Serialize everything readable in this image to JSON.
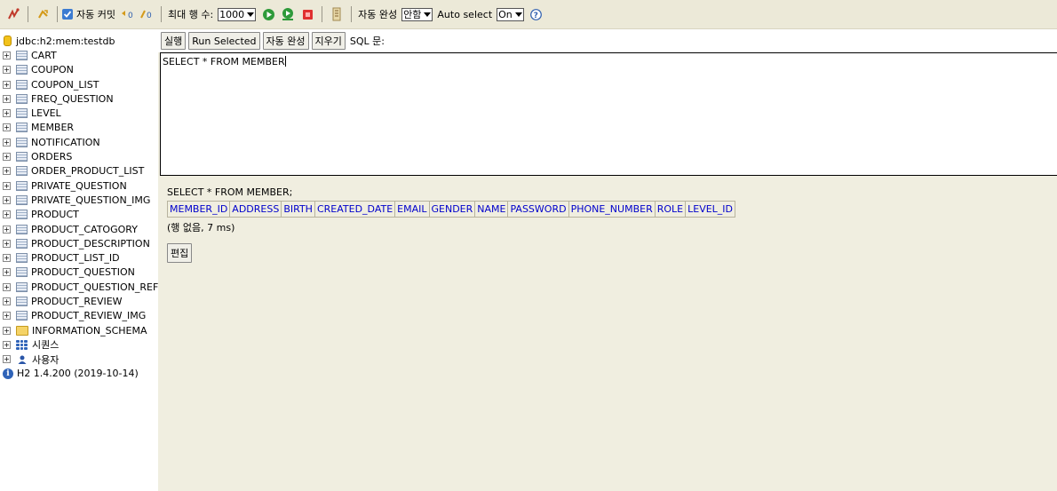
{
  "toolbar": {
    "autocommit_label": "자동 커밋",
    "max_rows_label": "최대 행 수:",
    "max_rows_value": "1000",
    "autocomplete_label": "자동 완성",
    "autocomplete_value": "안함",
    "auto_select_label": "Auto select",
    "auto_select_value": "On",
    "help_icon": "?"
  },
  "sidebar": {
    "connection": "jdbc:h2:mem:testdb",
    "tables": [
      "CART",
      "COUPON",
      "COUPON_LIST",
      "FREQ_QUESTION",
      "LEVEL",
      "MEMBER",
      "NOTIFICATION",
      "ORDERS",
      "ORDER_PRODUCT_LIST",
      "PRIVATE_QUESTION",
      "PRIVATE_QUESTION_IMG",
      "PRODUCT",
      "PRODUCT_CATOGORY",
      "PRODUCT_DESCRIPTION",
      "PRODUCT_LIST_ID",
      "PRODUCT_QUESTION",
      "PRODUCT_QUESTION_REF",
      "PRODUCT_REVIEW",
      "PRODUCT_REVIEW_IMG"
    ],
    "schema": "INFORMATION_SCHEMA",
    "sequences": "시퀀스",
    "users": "사용자",
    "version": "H2 1.4.200 (2019-10-14)"
  },
  "sql_bar": {
    "run_label": "실행",
    "run_selected_label": "Run Selected",
    "autocomplete_label": "자동 완성",
    "clear_label": "지우기",
    "sql_label": "SQL 문:"
  },
  "editor": {
    "text": "SELECT * FROM MEMBER"
  },
  "results": {
    "statement": "SELECT * FROM MEMBER;",
    "columns": [
      "MEMBER_ID",
      "ADDRESS",
      "BIRTH",
      "CREATED_DATE",
      "EMAIL",
      "GENDER",
      "NAME",
      "PASSWORD",
      "PHONE_NUMBER",
      "ROLE",
      "LEVEL_ID"
    ],
    "row_info": "(행 없음, 7 ms)",
    "edit_label": "편집"
  },
  "colors": {
    "toolbar_bg": "#ece9d8",
    "panel_bg": "#f0eee0",
    "column_header": "#0000cc"
  }
}
